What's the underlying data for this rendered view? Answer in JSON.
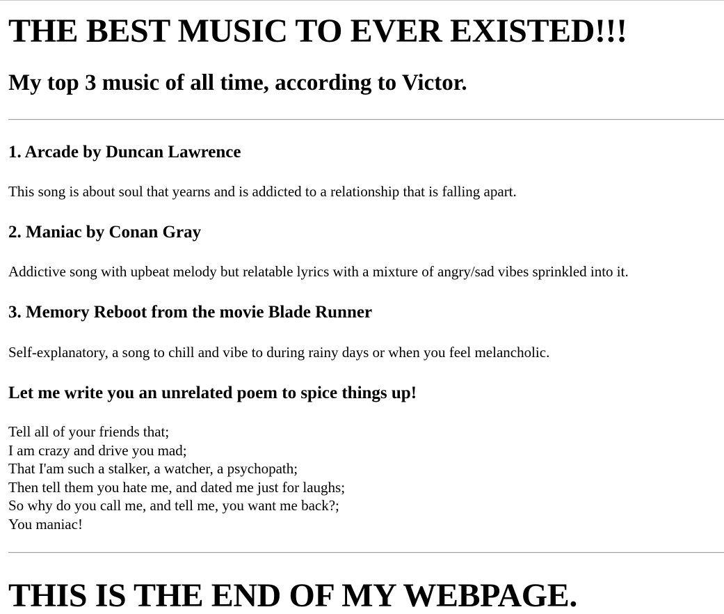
{
  "page": {
    "title": "THE BEST MUSIC TO EVER EXISTED!!!",
    "subtitle": "My top 3 music of all time, according to Victor.",
    "footer_title": "THIS IS THE END OF MY WEBPAGE."
  },
  "songs": [
    {
      "heading": "1. Arcade by Duncan Lawrence",
      "description": "This song is about soul that yearns and is addicted to a relationship that is falling apart."
    },
    {
      "heading": "2. Maniac by Conan Gray",
      "description": "Addictive song with upbeat melody but relatable lyrics with a mixture of angry/sad vibes sprinkled into it."
    },
    {
      "heading": "3. Memory Reboot from the movie Blade Runner",
      "description": "Self-explanatory, a song to chill and vibe to during rainy days or when you feel melancholic."
    }
  ],
  "poem": {
    "heading": "Let me write you an unrelated poem to spice things up!",
    "lines": [
      "Tell all of your friends that;",
      "I am crazy and drive you mad;",
      "That I'am such a stalker, a watcher, a psychopath;",
      "Then tell them you hate me, and dated me just for laughs;",
      "So why do you call me, and tell me, you want me back?;",
      "You maniac!"
    ]
  }
}
